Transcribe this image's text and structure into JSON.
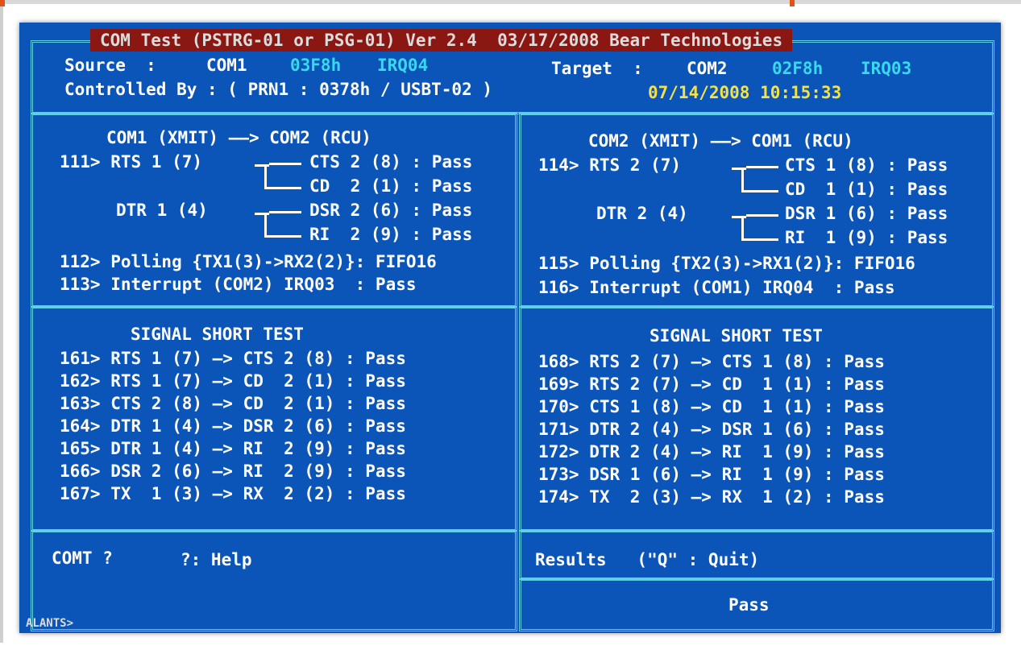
{
  "title": "COM Test (PSTRG-01 or PSG-01) Ver 2.4  03/17/2008 Bear Technologies",
  "header": {
    "source_label": "Source  :",
    "source_port": "COM1",
    "source_addr": "03F8h",
    "source_irq": "IRQ04",
    "target_label": "Target  :",
    "target_port": "COM2",
    "target_addr": "02F8h",
    "target_irq": "IRQ03",
    "controlled_label": "Controlled By : ( PRN1 : 0378h / USBT-02 )",
    "datetime": "07/14/2008 10:15:33"
  },
  "left_panel": {
    "heading": "COM1 (XMIT) ——> COM2 (RCU)",
    "lines": [
      "111> RTS 1 (7)",
      "CTS 2 (8) : Pass",
      "CD  2 (1) : Pass",
      "DTR 1 (4)",
      "DSR 2 (6) : Pass",
      "RI  2 (9) : Pass",
      "112> Polling {TX1(3)->RX2(2)}: FIFO16",
      "113> Interrupt (COM2) IRQ03  : Pass"
    ]
  },
  "right_panel": {
    "heading": "COM2 (XMIT) ——> COM1 (RCU)",
    "lines": [
      "114> RTS 2 (7)",
      "CTS 1 (8) : Pass",
      "CD  1 (1) : Pass",
      "DTR 2 (4)",
      "DSR 1 (6) : Pass",
      "RI  1 (9) : Pass",
      "115> Polling {TX2(3)->RX1(2)}: FIFO16",
      "116> Interrupt (COM1) IRQ04  : Pass"
    ]
  },
  "short_left": {
    "heading": "SIGNAL SHORT TEST",
    "rows": [
      "161> RTS 1 (7) —> CTS 2 (8) : Pass",
      "162> RTS 1 (7) —> CD  2 (1) : Pass",
      "163> CTS 2 (8) —> CD  2 (1) : Pass",
      "164> DTR 1 (4) —> DSR 2 (6) : Pass",
      "165> DTR 1 (4) —> RI  2 (9) : Pass",
      "166> DSR 2 (6) —> RI  2 (9) : Pass",
      "167> TX  1 (3) —> RX  2 (2) : Pass"
    ]
  },
  "short_right": {
    "heading": "SIGNAL SHORT TEST",
    "rows": [
      "168> RTS 2 (7) —> CTS 1 (8) : Pass",
      "169> RTS 2 (7) —> CD  1 (1) : Pass",
      "170> CTS 1 (8) —> CD  1 (1) : Pass",
      "171> DTR 2 (4) —> DSR 1 (6) : Pass",
      "172> DTR 2 (4) —> RI  1 (9) : Pass",
      "173> DSR 1 (6) —> RI  1 (9) : Pass",
      "174> TX  2 (3) —> RX  1 (2) : Pass"
    ]
  },
  "command": {
    "prompt": "COMT ?",
    "help": "?: Help"
  },
  "results": {
    "label": "Results   (\"Q\" : Quit)",
    "value": "Pass"
  },
  "corner_text": "ALANTS>"
}
